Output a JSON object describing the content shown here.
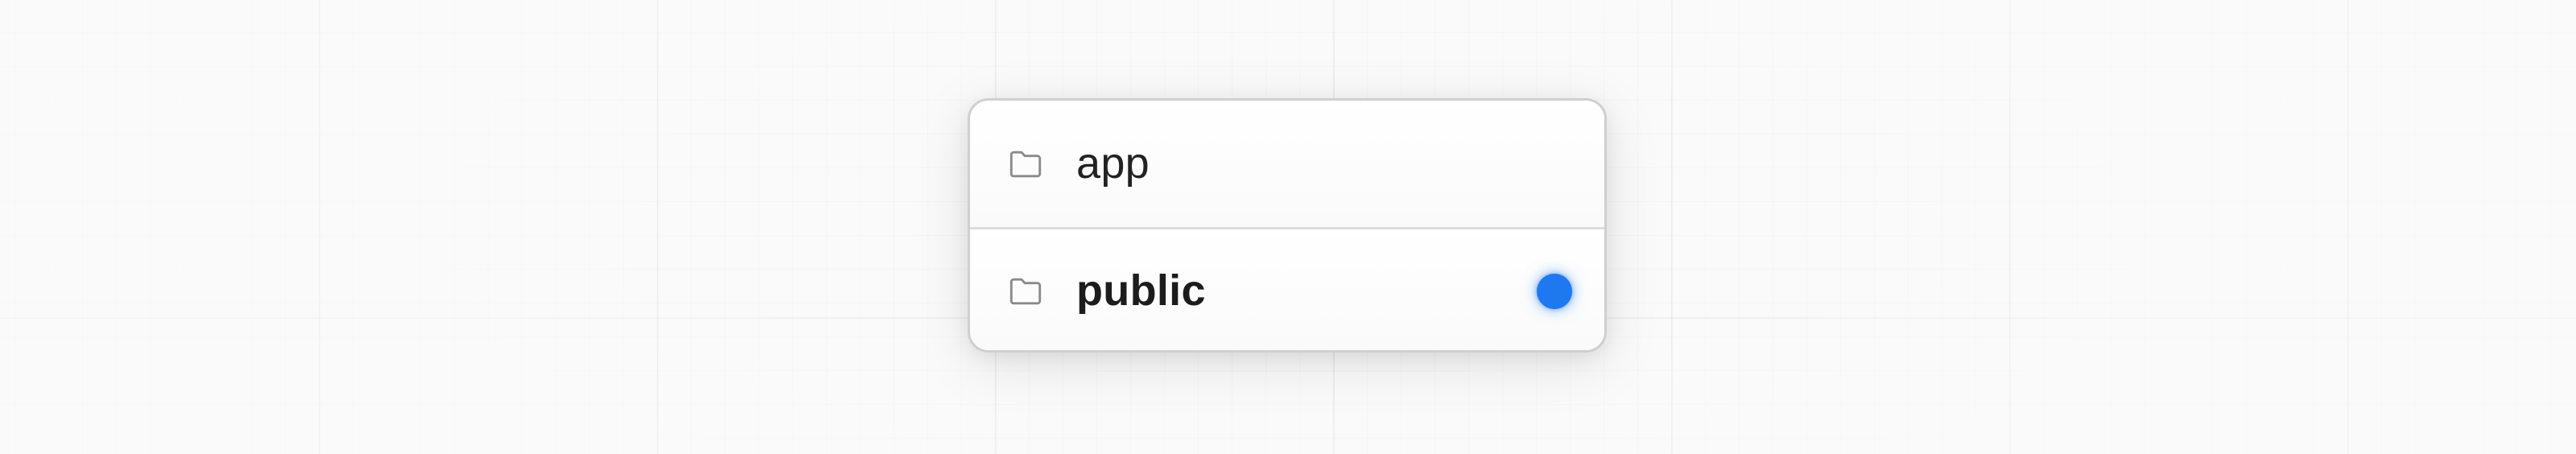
{
  "folders": [
    {
      "name": "app",
      "icon": "folder-icon",
      "bold": false,
      "highlighted": false
    },
    {
      "name": "public",
      "icon": "folder-icon",
      "bold": true,
      "highlighted": true
    }
  ],
  "colors": {
    "highlight_dot": "#1e78f0",
    "icon_stroke": "#8a8a8a",
    "text": "#222222"
  }
}
